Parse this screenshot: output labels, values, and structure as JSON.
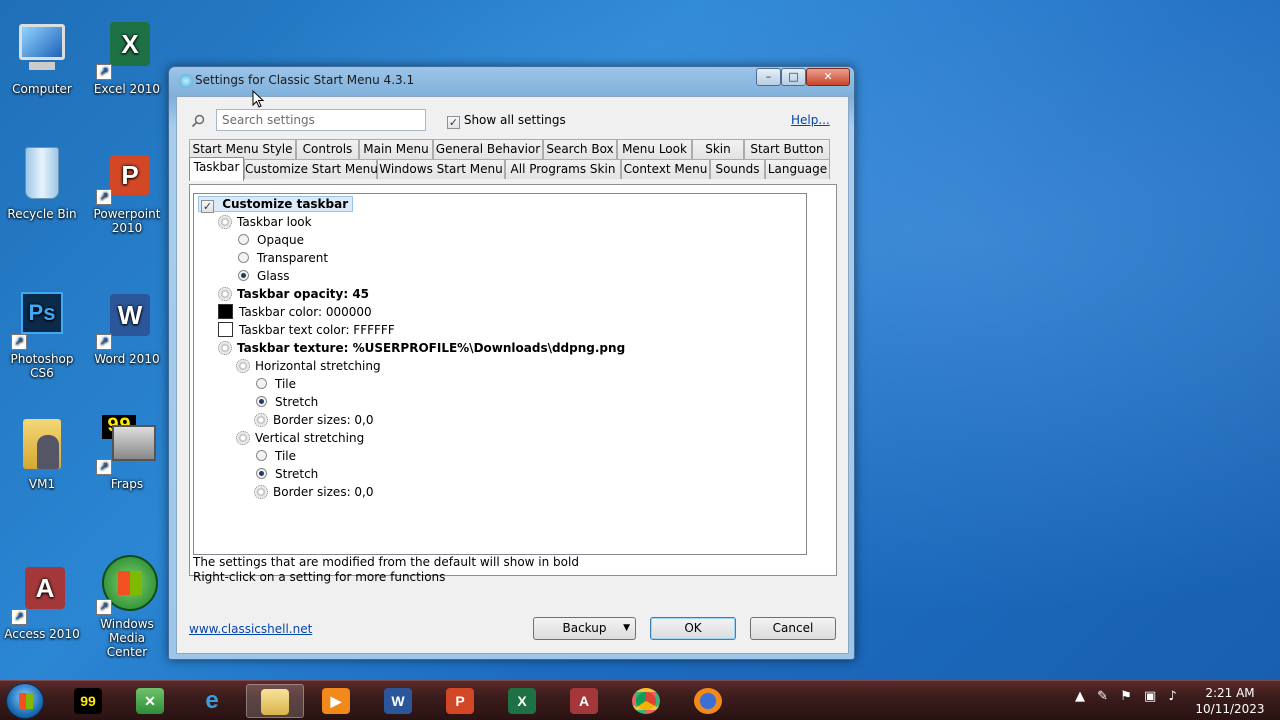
{
  "desktop": {
    "icons": [
      {
        "label": "Computer"
      },
      {
        "label": "Excel 2010"
      },
      {
        "label": "Recycle Bin"
      },
      {
        "label": "Powerpoint 2010"
      },
      {
        "label": "Photoshop CS6"
      },
      {
        "label": "Word 2010"
      },
      {
        "label": "VM1"
      },
      {
        "label": "Fraps"
      },
      {
        "label": "Access 2010"
      },
      {
        "label": "Windows Media Center"
      }
    ]
  },
  "window": {
    "title": "Settings for Classic Start Menu 4.3.1",
    "search_placeholder": "Search settings",
    "show_all_label": "Show all settings",
    "help_label": "Help...",
    "tabs_row1": [
      "Start Menu Style",
      "Controls",
      "Main Menu",
      "General Behavior",
      "Search Box",
      "Menu Look",
      "Skin",
      "Start Button"
    ],
    "tabs_row2": [
      "Taskbar",
      "Customize Start Menu",
      "Windows Start Menu",
      "All Programs Skin",
      "Context Menu",
      "Sounds",
      "Language"
    ],
    "tree": [
      "Customize taskbar",
      "Taskbar look",
      "Opaque",
      "Transparent",
      "Glass",
      "Taskbar opacity: 45",
      "Taskbar color: 000000",
      "Taskbar text color: FFFFFF",
      "Taskbar texture: %USERPROFILE%\\Downloads\\ddpng.png",
      "Horizontal stretching",
      "Tile",
      "Stretch",
      "Border sizes: 0,0",
      "Vertical stretching",
      "Tile",
      "Stretch",
      "Border sizes: 0,0"
    ],
    "note1": "The settings that are modified from the default will show in bold",
    "note2": "Right-click on a setting for more functions",
    "website": "www.classicshell.net",
    "backup_label": "Backup",
    "ok_label": "OK",
    "cancel_label": "Cancel",
    "swatch_colors": {
      "taskbar": "#000000",
      "text": "#FFFFFF"
    }
  },
  "taskbar": {
    "clock_time": "2:21 AM",
    "clock_date": "10/11/2023"
  }
}
